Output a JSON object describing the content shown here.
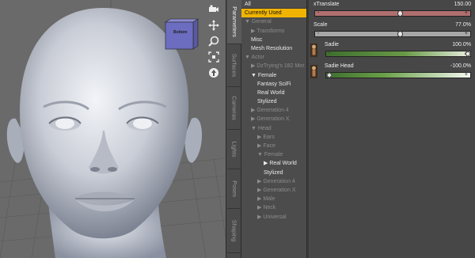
{
  "vertical_tabs": [
    "Parameters",
    "Surfaces",
    "Cameras",
    "Lights",
    "Poses",
    "Shaping"
  ],
  "active_tab": "Parameters",
  "viewport": {
    "cube_label": "Bottom"
  },
  "tree": [
    {
      "label": "All",
      "level": 0,
      "state": "top"
    },
    {
      "label": "Currently Used",
      "level": 0,
      "state": "selected"
    },
    {
      "label": "▼ General",
      "level": 0,
      "state": "dim"
    },
    {
      "label": "▶ Transforms",
      "level": 1,
      "state": "dim"
    },
    {
      "label": "Misc",
      "level": 1,
      "state": "normal"
    },
    {
      "label": "Mesh Resolution",
      "level": 1,
      "state": "normal"
    },
    {
      "label": "▼ Actor",
      "level": 0,
      "state": "dim"
    },
    {
      "label": "▶ DzTrying's 182 Mor…",
      "level": 1,
      "state": "dim"
    },
    {
      "label": "▼ Female",
      "level": 1,
      "state": "normal"
    },
    {
      "label": "Fantasy SciFi",
      "level": 2,
      "state": "normal"
    },
    {
      "label": "Real World",
      "level": 2,
      "state": "normal"
    },
    {
      "label": "Stylized",
      "level": 2,
      "state": "normal"
    },
    {
      "label": "▶ Generation 4",
      "level": 1,
      "state": "dim"
    },
    {
      "label": "▶ Generation X",
      "level": 1,
      "state": "dim"
    },
    {
      "label": "▼ Head",
      "level": 1,
      "state": "dim"
    },
    {
      "label": "▶ Ears",
      "level": 2,
      "state": "dim"
    },
    {
      "label": "▶ Face",
      "level": 2,
      "state": "dim"
    },
    {
      "label": "▼ Female",
      "level": 2,
      "state": "dim"
    },
    {
      "label": "▶ Real World",
      "level": 3,
      "state": "normal"
    },
    {
      "label": "Stylized",
      "level": 3,
      "state": "normal"
    },
    {
      "label": "▶ Generation 4",
      "level": 2,
      "state": "dim"
    },
    {
      "label": "▶ Generation X",
      "level": 2,
      "state": "dim"
    },
    {
      "label": "▶ Male",
      "level": 2,
      "state": "dim"
    },
    {
      "label": "▶ Neck",
      "level": 2,
      "state": "dim"
    },
    {
      "label": "▶ Universal",
      "level": 2,
      "state": "dim"
    }
  ],
  "properties": [
    {
      "label": "xTranslate",
      "value": "150.00",
      "fill": 0.55,
      "style": "red",
      "knob": "round"
    },
    {
      "label": "Scale",
      "value": "77.0%",
      "fill": 0.55,
      "style": "gray",
      "knob": "round"
    },
    {
      "label": "Sadie",
      "value": "100.0%",
      "fill": 0.99,
      "style": "green",
      "knob": "diamond",
      "thumb": true
    },
    {
      "label": "Sadie Head",
      "value": "-100.0%",
      "fill": 0.03,
      "style": "greenhead",
      "knob": "diamond",
      "thumb": true
    }
  ]
}
